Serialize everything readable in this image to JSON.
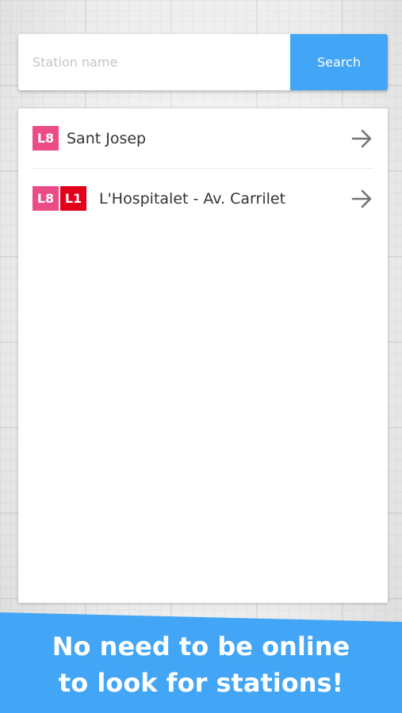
{
  "colors": {
    "accent": "#42a5f5",
    "L8": "#ec4c86",
    "L1": "#e2001a",
    "arrow": "#757575"
  },
  "search": {
    "placeholder": "Station name",
    "value": "",
    "button_label": "Search"
  },
  "results": [
    {
      "name": "Sant Josep",
      "lines": [
        {
          "label": "L8",
          "color": "#ec4c86"
        }
      ],
      "icon": "arrow-right-icon"
    },
    {
      "name": "L'Hospitalet - Av. Carrilet",
      "lines": [
        {
          "label": "L8",
          "color": "#ec4c86"
        },
        {
          "label": "L1",
          "color": "#e2001a"
        }
      ],
      "icon": "arrow-right-icon"
    }
  ],
  "banner": {
    "line1": "No need to be online",
    "line2": "to look for stations!"
  }
}
